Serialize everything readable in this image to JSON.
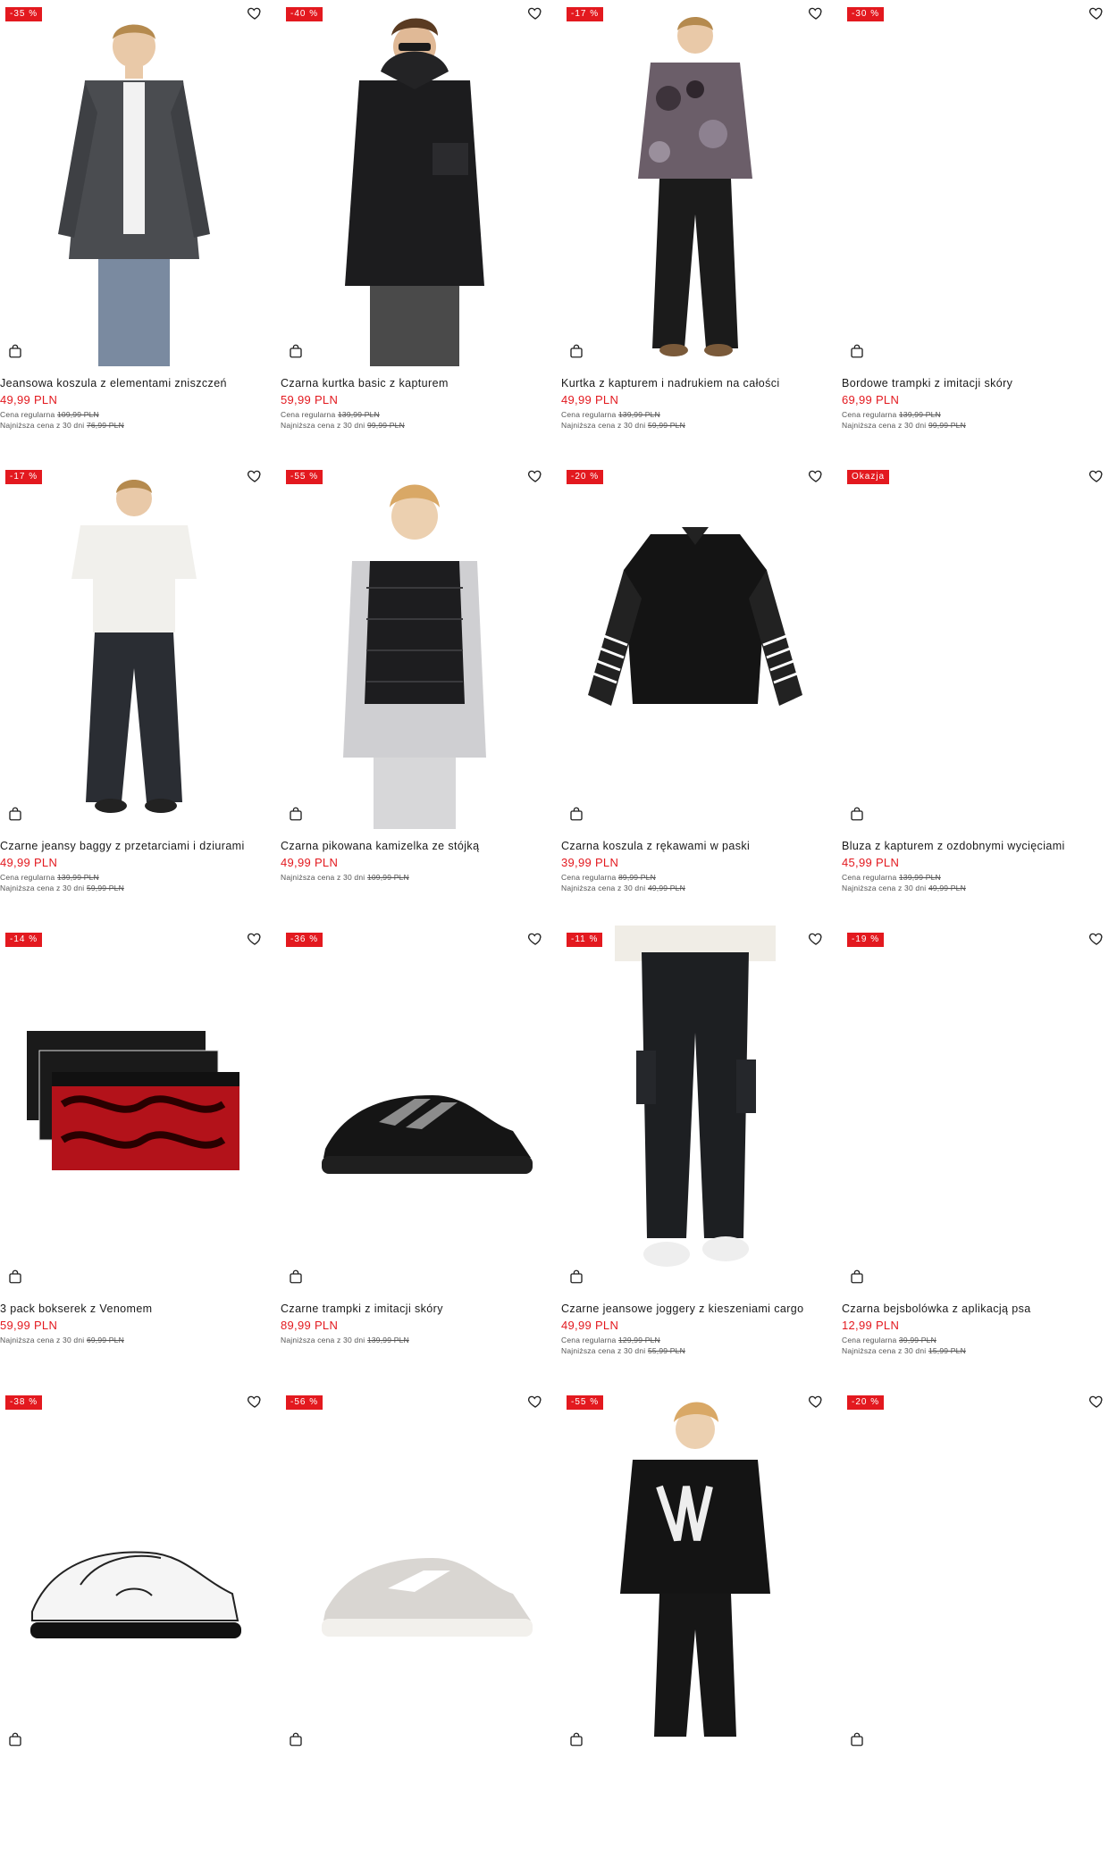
{
  "colors": {
    "badge": "#e3191f",
    "price": "#e3191f"
  },
  "labels": {
    "regular": "Cena regularna",
    "lowest": "Najniższa cena z 30 dni"
  },
  "products": [
    {
      "badge": "-35 %",
      "name": "Jeansowa koszula z elementami zniszczeń",
      "price": "49,99 PLN",
      "regular": "109,99 PLN",
      "lowest": "76,99 PLN",
      "icon": "denim-shirt-model"
    },
    {
      "badge": "-40 %",
      "name": "Czarna kurtka basic z kapturem",
      "price": "59,99 PLN",
      "regular": "139,99 PLN",
      "lowest": "99,99 PLN",
      "icon": "black-jacket-model"
    },
    {
      "badge": "-17 %",
      "name": "Kurtka z kapturem i nadrukiem na całości",
      "price": "49,99 PLN",
      "regular": "139,99 PLN",
      "lowest": "59,99 PLN",
      "icon": "camo-jacket-model"
    },
    {
      "badge": "-30 %",
      "name": "Bordowe trampki z imitacji skóry",
      "price": "69,99 PLN",
      "regular": "139,99 PLN",
      "lowest": "99,99 PLN",
      "icon": "empty-image"
    },
    {
      "badge": "-17 %",
      "name": "Czarne jeansy baggy z przetarciami i dziurami",
      "price": "49,99 PLN",
      "regular": "139,99 PLN",
      "lowest": "59,99 PLN",
      "icon": "baggy-jeans-model"
    },
    {
      "badge": "-55 %",
      "name": "Czarna pikowana kamizelka ze stójką",
      "price": "49,99 PLN",
      "regular": "",
      "lowest": "109,99 PLN",
      "icon": "puffer-vest-model"
    },
    {
      "badge": "-20 %",
      "name": "Czarna koszula z rękawami w paski",
      "price": "39,99 PLN",
      "regular": "89,99 PLN",
      "lowest": "49,99 PLN",
      "icon": "striped-sleeve-shirt"
    },
    {
      "badge": "Okazja",
      "name": "Bluza z kapturem z ozdobnymi wycięciami",
      "price": "45,99 PLN",
      "regular": "139,99 PLN",
      "lowest": "49,99 PLN",
      "icon": "empty-image"
    },
    {
      "badge": "-14 %",
      "name": "3 pack bokserek z Venomem",
      "price": "59,99 PLN",
      "regular": "",
      "lowest": "69,99 PLN",
      "icon": "venom-boxers"
    },
    {
      "badge": "-36 %",
      "name": "Czarne trampki z imitacji skóry",
      "price": "89,99 PLN",
      "regular": "",
      "lowest": "139,99 PLN",
      "icon": "black-sneaker"
    },
    {
      "badge": "-11 %",
      "name": "Czarne jeansowe joggery z kieszeniami cargo",
      "price": "49,99 PLN",
      "regular": "129,99 PLN",
      "lowest": "55,99 PLN",
      "icon": "cargo-joggers-model"
    },
    {
      "badge": "-19 %",
      "name": "Czarna bejsbolówka z aplikacją psa",
      "price": "12,99 PLN",
      "regular": "39,99 PLN",
      "lowest": "15,99 PLN",
      "icon": "empty-image"
    },
    {
      "badge": "-38 %",
      "name": "",
      "price": "",
      "regular": "",
      "lowest": "",
      "icon": "white-graffiti-sneaker"
    },
    {
      "badge": "-56 %",
      "name": "",
      "price": "",
      "regular": "",
      "lowest": "",
      "icon": "grey-sneaker"
    },
    {
      "badge": "-55 %",
      "name": "",
      "price": "",
      "regular": "",
      "lowest": "",
      "icon": "black-fleece-model"
    },
    {
      "badge": "-20 %",
      "name": "",
      "price": "",
      "regular": "",
      "lowest": "",
      "icon": "empty-image"
    }
  ]
}
